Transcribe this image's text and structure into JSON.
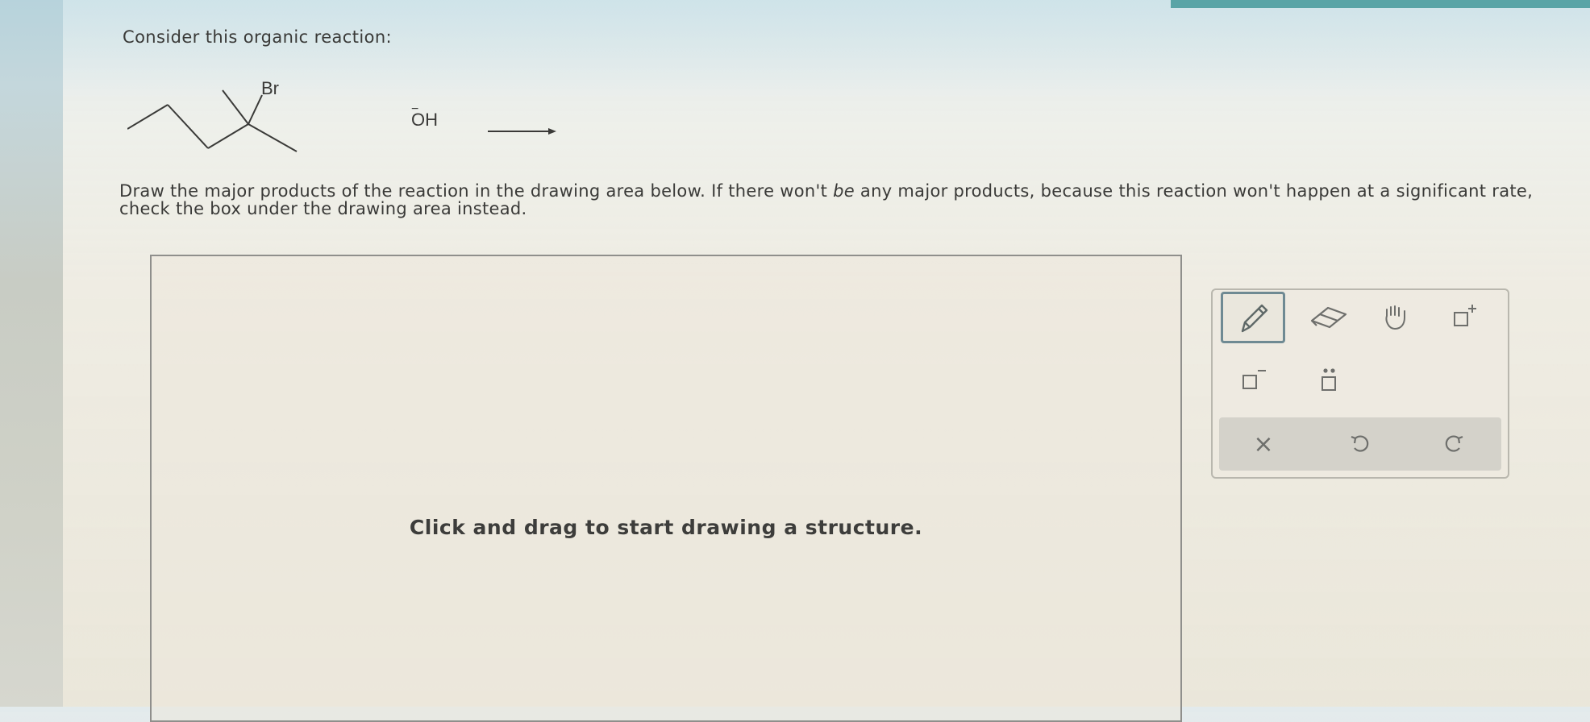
{
  "prompt": {
    "intro": "Consider this organic reaction:",
    "instructions_part1": "Draw the major products of the reaction in the drawing area below. If there won't ",
    "instructions_emphasis": "be",
    "instructions_part2": " any major products, because this reaction won't happen at a significant rate, check the box under the drawing area instead."
  },
  "reaction": {
    "substituent_label": "Br",
    "reagent_charge": "−",
    "reagent_label": "OH",
    "arrow": "reaction-arrow"
  },
  "drawing_area": {
    "hint": "Click and drag to start drawing a structure."
  },
  "toolbar": {
    "tools": [
      {
        "name": "pencil",
        "icon": "pencil-icon",
        "selected": true
      },
      {
        "name": "eraser",
        "icon": "eraser-icon",
        "selected": false
      },
      {
        "name": "hand",
        "icon": "hand-icon",
        "selected": false
      },
      {
        "name": "positive-charge",
        "icon": "positive-charge-icon",
        "superscript": "+",
        "selected": false
      },
      {
        "name": "negative-charge",
        "icon": "negative-charge-icon",
        "superscript": "−",
        "selected": false
      },
      {
        "name": "lone-pair",
        "icon": "lone-pair-icon",
        "selected": false
      }
    ],
    "actions": [
      {
        "name": "clear",
        "icon": "close-icon",
        "glyph": "×"
      },
      {
        "name": "undo",
        "icon": "undo-icon"
      },
      {
        "name": "redo",
        "icon": "redo-icon"
      }
    ]
  },
  "colors": {
    "text": "#3a3a38",
    "selected_border": "#6f8a93",
    "accent_bar": "#59a4a6"
  }
}
